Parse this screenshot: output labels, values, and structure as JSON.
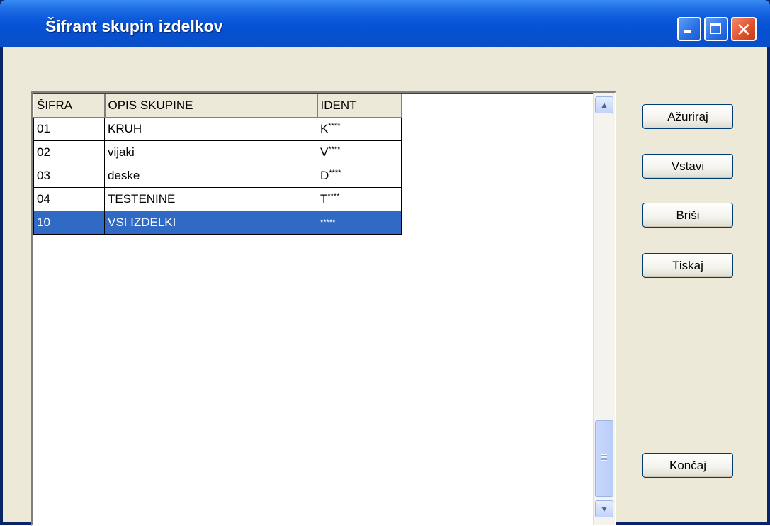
{
  "window": {
    "title": "Šifrant skupin izdelkov"
  },
  "table": {
    "columns": [
      "ŠIFRA",
      "OPIS SKUPINE",
      "IDENT"
    ],
    "rows": [
      {
        "code": "01",
        "description": "KRUH",
        "ident_prefix": "K",
        "ident_mask": "****"
      },
      {
        "code": "02",
        "description": "vijaki",
        "ident_prefix": "V",
        "ident_mask": "****"
      },
      {
        "code": "03",
        "description": "deske",
        "ident_prefix": "D",
        "ident_mask": "****"
      },
      {
        "code": "04",
        "description": "TESTENINE",
        "ident_prefix": "T",
        "ident_mask": "****"
      },
      {
        "code": "10",
        "description": "VSI IZDELKI",
        "ident_prefix": "",
        "ident_mask": "*****"
      }
    ],
    "selected_row_code": "10"
  },
  "buttons": {
    "update": "Ažuriraj",
    "insert": "Vstavi",
    "delete": "Briši",
    "print": "Tiskaj",
    "finish": "Končaj"
  },
  "colors": {
    "titlebar": "#0a56d8",
    "selection": "#316ac5",
    "window_bg": "#ece9d8"
  }
}
